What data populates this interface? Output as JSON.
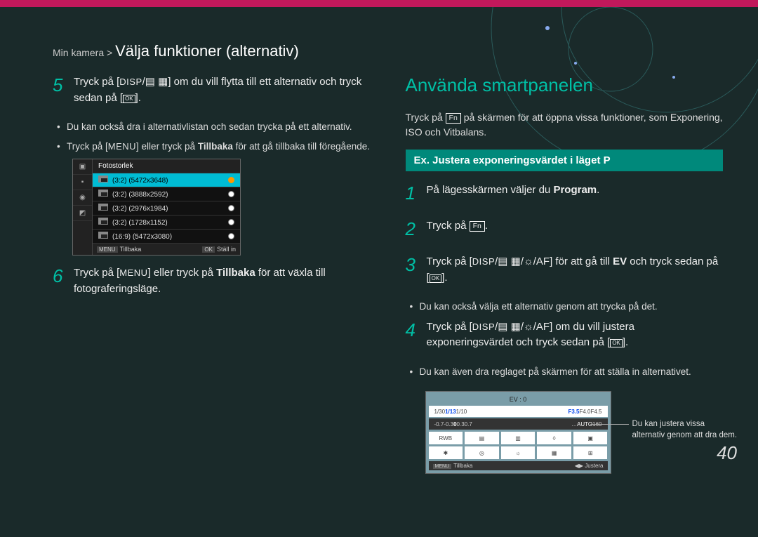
{
  "breadcrumb": {
    "prefix": "Min kamera >",
    "title": "Välja funktioner (alternativ)"
  },
  "left": {
    "step5": {
      "num": "5",
      "text_a": "Tryck på [",
      "text_b": "] om du vill ﬂytta till ett alternativ och tryck sedan på [",
      "text_c": "].",
      "disp": "DISP",
      "ok": "OK"
    },
    "bullets5": [
      "Du kan också dra i alternativlistan och sedan trycka på ett alternativ.",
      {
        "a": "Tryck på [",
        "m": "MENU",
        "b": "] eller tryck på ",
        "bold": "Tillbaka",
        "c": " för att gå tillbaka till föregående."
      }
    ],
    "lcd": {
      "header": "Fotostorlek",
      "items": [
        "(3:2) (5472x3648)",
        "(3:2) (3888x2592)",
        "(3:2) (2976x1984)",
        "(3:2) (1728x1152)",
        "(16:9) (5472x3080)"
      ],
      "back_key": "MENU",
      "back_label": "Tillbaka",
      "ok_key": "OK",
      "ok_label": "Ställ in"
    },
    "step6": {
      "num": "6",
      "a": "Tryck på [",
      "m": "MENU",
      "b": "] eller tryck på ",
      "bold": "Tillbaka",
      "c": " för att växla till fotograferingsläge."
    }
  },
  "right": {
    "title": "Använda smartpanelen",
    "intro_a": "Tryck på ",
    "intro_fn": "Fn",
    "intro_b": " på skärmen för att öppna vissa funktioner, som Exponering, ISO och Vitbalans.",
    "ex": "Ex. Justera exponeringsvärdet i läget P",
    "step1": {
      "num": "1",
      "a": "På lägesskärmen väljer du ",
      "bold": "Program",
      "b": "."
    },
    "step2": {
      "num": "2",
      "a": "Tryck på ",
      "fn": "Fn",
      "b": "."
    },
    "step3": {
      "num": "3",
      "a": "Tryck på [",
      "disp": "DISP",
      "slash": "/",
      "af": "AF",
      "b": "] för att gå till ",
      "bold": "EV",
      "c": " och tryck sedan på [",
      "ok": "OK",
      "d": "]."
    },
    "bullet3": "Du kan också välja ett alternativ genom att trycka på det.",
    "step4": {
      "num": "4",
      "a": "Tryck på [",
      "disp": "DISP",
      "slash": "/",
      "af": "AF",
      "b": "] om du vill justera exponeringsvärdet och tryck sedan på [",
      "ok": "OK",
      "c": "]."
    },
    "bullet4": "Du kan även dra reglaget på skärmen för att ställa in alternativet.",
    "lcd": {
      "ev": "EV : 0",
      "strip1": {
        "l": "1/30",
        "c": "1/13",
        "r1": "F3.5",
        "r2": "F4.0",
        "r3": "F4.5",
        "l2": "1/10"
      },
      "strip2": {
        "vals": [
          "-0.7",
          "-0.3",
          "0",
          "0.3",
          "0.7"
        ],
        "auto": "AUTO",
        "isoL": "…",
        "isoR": "160"
      },
      "row": [
        "RWB",
        "▤",
        "▥",
        "◊",
        "▣"
      ],
      "row2": [
        "✱",
        "◎",
        "☼",
        "▦",
        "⊞"
      ],
      "back_key": "MENU",
      "back_label": "Tillbaka",
      "adj_label": "Justera"
    },
    "callout": "Du kan justera vissa alternativ genom att dra dem."
  },
  "page": "40"
}
